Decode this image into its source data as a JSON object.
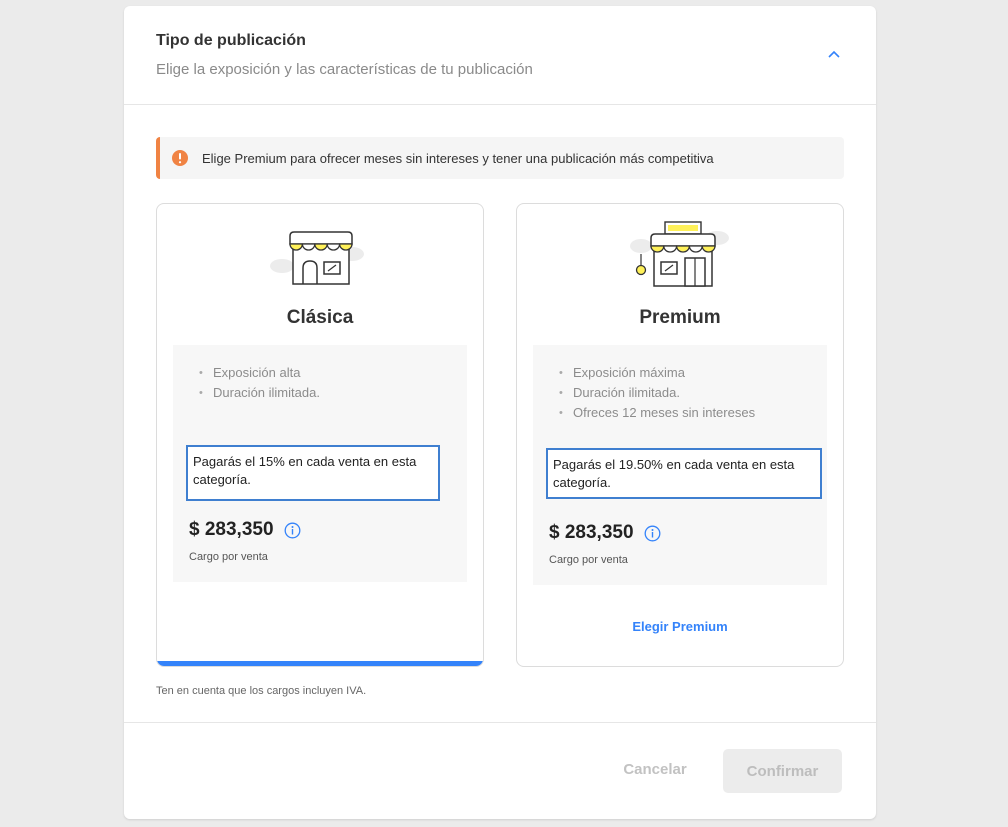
{
  "header": {
    "title": "Tipo de publicación",
    "subtitle": "Elige la exposición y las características de tu publicación",
    "collapse_icon": "chevron-up-icon"
  },
  "alert": {
    "icon": "exclamation-circle-icon",
    "text": "Elige Premium para ofrecer meses sin intereses y tener una publicación más competitiva",
    "accent_color": "#f08343"
  },
  "cards": {
    "classic": {
      "illustration": "store-icon",
      "title": "Clásica",
      "features": [
        "Exposición alta",
        "Duración ilimitada."
      ],
      "fee_text": "Pagarás el 15% en cada venta en esta categoría.",
      "price": "$ 283,350",
      "price_caption": "Cargo por venta",
      "selected": true
    },
    "premium": {
      "illustration": "premium-store-icon",
      "title": "Premium",
      "features": [
        "Exposición máxima",
        "Duración ilimitada.",
        "Ofreces 12 meses sin intereses"
      ],
      "fee_text": "Pagarás el 19.50% en cada venta en esta categoría.",
      "price": "$ 283,350",
      "price_caption": "Cargo por venta",
      "choose_label": "Elegir Premium",
      "selected": false
    }
  },
  "note": "Ten en cuenta que los cargos incluyen IVA.",
  "footer": {
    "cancel_label": "Cancelar",
    "confirm_label": "Confirmar"
  },
  "colors": {
    "accent": "#3483fa",
    "highlight_box": "#3f7fd0",
    "awning_yellow": "#fff159"
  }
}
